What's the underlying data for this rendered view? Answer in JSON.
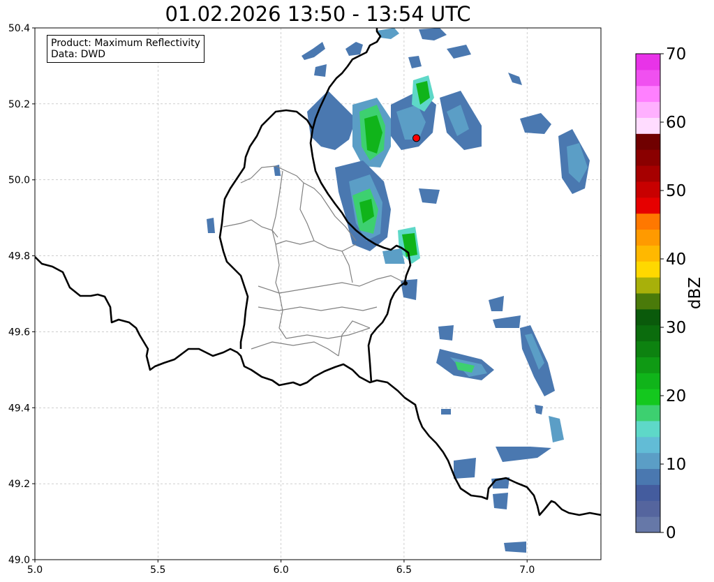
{
  "title": "01.02.2026 13:50 - 13:54 UTC",
  "info": {
    "product_line": "Product: Maximum Reflectivity",
    "data_line": "Data: DWD"
  },
  "map": {
    "lon_range": [
      5.0,
      7.3
    ],
    "lat_range": [
      49.0,
      50.4
    ],
    "x_ticks": [
      "5.0",
      "5.5",
      "6.0",
      "6.5",
      "7.0"
    ],
    "x_tick_values": [
      5.0,
      5.5,
      6.0,
      6.5,
      7.0
    ],
    "y_ticks": [
      "49.0",
      "49.2",
      "49.4",
      "49.6",
      "49.8",
      "50.0",
      "50.2",
      "50.4"
    ],
    "y_tick_values": [
      49.0,
      49.2,
      49.4,
      49.6,
      49.8,
      50.0,
      50.2,
      50.4
    ],
    "grid": true,
    "radar_site": {
      "lon": 6.55,
      "lat": 50.11,
      "color": "#ff0000"
    },
    "country_border_color": "#000000",
    "district_border_color": "#808080"
  },
  "colorbar": {
    "label": "dBZ",
    "ticks": [
      "0",
      "10",
      "20",
      "30",
      "40",
      "50",
      "60",
      "70"
    ],
    "tick_values": [
      0,
      10,
      20,
      30,
      40,
      50,
      60,
      70
    ],
    "colors": [
      "#6678a8",
      "#55659e",
      "#445c9e",
      "#4a78b0",
      "#5b9ec6",
      "#62bcd6",
      "#5ed8c8",
      "#3dd070",
      "#14c81e",
      "#10b41a",
      "#0f9a14",
      "#0d8210",
      "#0b6c0d",
      "#0a5a0b",
      "#4a7a0a",
      "#a8b00a",
      "#ffd800",
      "#ffb800",
      "#ff9a00",
      "#ff7800",
      "#e60000",
      "#c80000",
      "#a60000",
      "#8a0000",
      "#700000",
      "#ffdcff",
      "#ffb0ff",
      "#ff80ff",
      "#f050f0",
      "#e833e8"
    ]
  }
}
